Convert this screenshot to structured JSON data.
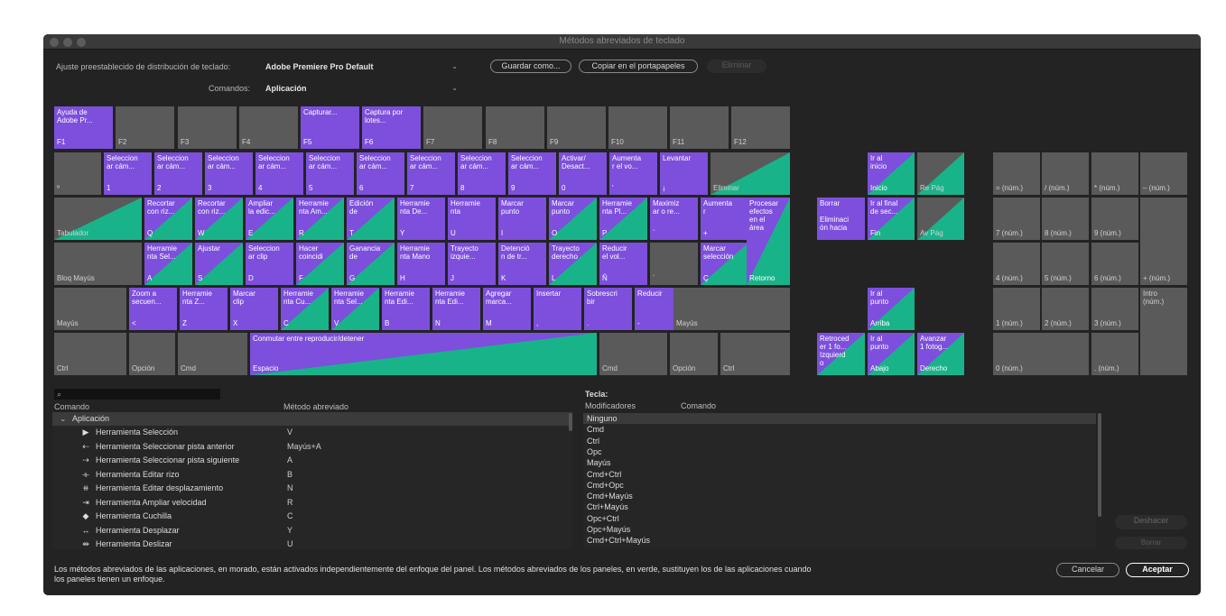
{
  "window": {
    "title": "Métodos abreviados de teclado"
  },
  "toolbar": {
    "preset_label": "Ajuste preestablecido de distribución de teclado:",
    "preset_value": "Adobe Premiere Pro Default",
    "commands_label": "Comandos:",
    "commands_value": "Aplicación",
    "save_as": "Guardar como...",
    "copy_clipboard": "Copiar en el portapapeles",
    "delete": "Eliminar"
  },
  "keyboard": {
    "fn_row": [
      {
        "t": "Ayuda de\nAdobe Pr...",
        "n": "F1",
        "c": "p"
      },
      {
        "t": "",
        "n": "F2",
        "c": "g"
      },
      {
        "t": "",
        "n": "F3",
        "c": "g"
      },
      {
        "t": "",
        "n": "F4",
        "c": "g"
      },
      {
        "t": "Capturar...",
        "n": "F5",
        "c": "p"
      },
      {
        "t": "Captura por\nlotes...",
        "n": "F6",
        "c": "p"
      },
      {
        "t": "",
        "n": "F7",
        "c": "g"
      },
      {
        "t": "",
        "n": "F8",
        "c": "g"
      },
      {
        "t": "",
        "n": "F9",
        "c": "g"
      },
      {
        "t": "",
        "n": "F10",
        "c": "g"
      },
      {
        "t": "",
        "n": "F11",
        "c": "g"
      },
      {
        "t": "",
        "n": "F12",
        "c": "g"
      }
    ],
    "num_row": [
      {
        "t": "",
        "n": "º",
        "c": "g"
      },
      {
        "t": "Seleccion\nar cám...",
        "n": "1",
        "c": "p"
      },
      {
        "t": "Seleccion\nar cám...",
        "n": "2",
        "c": "p"
      },
      {
        "t": "Seleccion\nar cám...",
        "n": "3",
        "c": "p"
      },
      {
        "t": "Seleccion\nar cám...",
        "n": "4",
        "c": "p"
      },
      {
        "t": "Seleccion\nar cám...",
        "n": "5",
        "c": "p"
      },
      {
        "t": "Seleccion\nar cám...",
        "n": "6",
        "c": "p"
      },
      {
        "t": "Seleccion\nar cám...",
        "n": "7",
        "c": "p"
      },
      {
        "t": "Seleccion\nar cám...",
        "n": "8",
        "c": "p"
      },
      {
        "t": "Seleccion\nar cám...",
        "n": "9",
        "c": "p"
      },
      {
        "t": "Activar/\nDesact...",
        "n": "0",
        "c": "p"
      },
      {
        "t": "Aumenta\nr el vo...",
        "n": "'",
        "c": "p"
      },
      {
        "t": "Levantar",
        "n": "¡",
        "c": "p"
      },
      {
        "t": "",
        "n": "Eliminar",
        "c": "gt"
      }
    ],
    "q_row": [
      {
        "t": "",
        "n": "Tabulador",
        "c": "gt"
      },
      {
        "t": "Recortar\ncon riz...",
        "n": "Q",
        "c": "pt"
      },
      {
        "t": "Recortar\ncon riz...",
        "n": "W",
        "c": "pt"
      },
      {
        "t": "Ampliar\nla edic...",
        "n": "E",
        "c": "pt"
      },
      {
        "t": "Herramie\nnta Am...",
        "n": "R",
        "c": "pt"
      },
      {
        "t": "Edición\nde",
        "n": "T",
        "c": "pt"
      },
      {
        "t": "Herramie\nnta De...",
        "n": "Y",
        "c": "p"
      },
      {
        "t": "Herramie\nnta",
        "n": "U",
        "c": "p"
      },
      {
        "t": "Marcar\npunto",
        "n": "I",
        "c": "p"
      },
      {
        "t": "Marcar\npunto",
        "n": "O",
        "c": "pt"
      },
      {
        "t": "Herramie\nnta Pl...",
        "n": "P",
        "c": "pt"
      },
      {
        "t": "Maximiz\nar o re...",
        "n": "`",
        "c": "p"
      },
      {
        "t": "Aumenta\nr",
        "n": "+",
        "c": "p"
      }
    ],
    "a_row": [
      {
        "t": "",
        "n": "Bloq Mayús",
        "c": "g"
      },
      {
        "t": "Herramie\nnta Sel...",
        "n": "A",
        "c": "pt"
      },
      {
        "t": "Ajustar",
        "n": "S",
        "c": "pt"
      },
      {
        "t": "Seleccion\nar clip",
        "n": "D",
        "c": "p"
      },
      {
        "t": "Hacer\ncoincidi",
        "n": "F",
        "c": "pt"
      },
      {
        "t": "Ganancia\nde",
        "n": "G",
        "c": "pt"
      },
      {
        "t": "Herramie\nnta Mano",
        "n": "H",
        "c": "p"
      },
      {
        "t": "Trayecto\nizquie...",
        "n": "J",
        "c": "p"
      },
      {
        "t": "Detenció\nn de tr...",
        "n": "K",
        "c": "p"
      },
      {
        "t": "Trayecto\nderecho",
        "n": "L",
        "c": "pt"
      },
      {
        "t": "Reducir\nel vol...",
        "n": "Ñ",
        "c": "p"
      },
      {
        "t": "",
        "n": "´",
        "c": "g"
      },
      {
        "t": "Marcar\nselección",
        "n": "Ç",
        "c": "pt"
      }
    ],
    "ret_key": {
      "t": "Procesar\nefectos\nen el\nárea",
      "n": "Retorno"
    },
    "z_row": [
      {
        "t": "",
        "n": "Mayús",
        "c": "g"
      },
      {
        "t": "Zoom a\nsecuen...",
        "n": "<",
        "c": "p"
      },
      {
        "t": "Herramie\nnta Z...",
        "n": "Z",
        "c": "p"
      },
      {
        "t": "Marcar\nclip",
        "n": "X",
        "c": "p"
      },
      {
        "t": "Herramie\nnta Cu...",
        "n": "C",
        "c": "pt"
      },
      {
        "t": "Herramie\nnta Sel...",
        "n": "V",
        "c": "pt"
      },
      {
        "t": "Herramie\nnta Edi...",
        "n": "B",
        "c": "p"
      },
      {
        "t": "Herramie\nnta Edi...",
        "n": "N",
        "c": "p"
      },
      {
        "t": "Agregar\nmarca...",
        "n": "M",
        "c": "p"
      },
      {
        "t": "Insertar",
        "n": ",",
        "c": "p"
      },
      {
        "t": "Sobrescri\nbir",
        "n": ".",
        "c": "p"
      },
      {
        "t": "Reducir",
        "n": "-",
        "c": "p"
      },
      {
        "t": "",
        "n": "Mayús",
        "c": "g"
      }
    ],
    "bottom_row": [
      {
        "t": "",
        "n": "Ctrl",
        "c": "g"
      },
      {
        "t": "",
        "n": "Opción",
        "c": "g"
      },
      {
        "t": "",
        "n": "Cmd",
        "c": "g"
      },
      {
        "t": "Conmutar entre reproducir/detener",
        "n": "Espacio",
        "c": "pt"
      },
      {
        "t": "",
        "n": "Cmd",
        "c": "g"
      },
      {
        "t": "",
        "n": "Opción",
        "c": "g"
      },
      {
        "t": "",
        "n": "Ctrl",
        "c": "g"
      }
    ],
    "nav_keys": [
      {
        "t": "Ir al\ninicio",
        "n": "Inicio",
        "c": "pt"
      },
      {
        "t": "",
        "n": "Re Pág",
        "c": "gt"
      },
      {
        "t": "Borrar\n\nEliminaci\nón hacia",
        "n": "",
        "c": "p"
      },
      {
        "t": "Ir al final\nde sec...",
        "n": "Fin",
        "c": "pt"
      },
      {
        "t": "",
        "n": "Av Pág",
        "c": "gt"
      },
      {
        "t": "Ir al\npunto",
        "n": "Arriba",
        "c": "pt"
      },
      {
        "t": "Retroced\ner 1 fo...\nIzquierd\no",
        "n": "",
        "c": "pt"
      },
      {
        "t": "Ir al\npunto",
        "n": "Abajo",
        "c": "pt"
      },
      {
        "t": "Avanzar\n1 fotog...",
        "n": "Derecho",
        "c": "pt"
      }
    ],
    "numpad": [
      {
        "t": "",
        "n": "= (núm.)"
      },
      {
        "t": "",
        "n": "/ (núm.)"
      },
      {
        "t": "",
        "n": "* (núm.)"
      },
      {
        "t": "",
        "n": "– (núm.)"
      },
      {
        "t": "",
        "n": "7 (núm.)"
      },
      {
        "t": "",
        "n": "8 (núm.)"
      },
      {
        "t": "",
        "n": "9 (núm.)"
      },
      {
        "t": "",
        "n": "+ (núm.)"
      },
      {
        "t": "",
        "n": "4 (núm.)"
      },
      {
        "t": "",
        "n": "5 (núm.)"
      },
      {
        "t": "",
        "n": "6 (núm.)"
      },
      {
        "t": "",
        "n": "1 (núm.)"
      },
      {
        "t": "",
        "n": "2 (núm.)"
      },
      {
        "t": "",
        "n": "3 (núm.)"
      },
      {
        "t": "Intro\n(núm.)",
        "n": ""
      },
      {
        "t": "",
        "n": "0 (núm.)"
      },
      {
        "t": "",
        "n": ". (núm.)"
      }
    ]
  },
  "command_panel": {
    "search_icon": "search-icon",
    "col_command": "Comando",
    "col_shortcut": "Método abreviado",
    "group": "Aplicación",
    "rows": [
      {
        "icon": "▶",
        "label": "Herramienta Selección",
        "shortcut": "V"
      },
      {
        "icon": "⇠",
        "label": "Herramienta Seleccionar pista anterior",
        "shortcut": "Mayús+A"
      },
      {
        "icon": "⇢",
        "label": "Herramienta Seleccionar pista siguiente",
        "shortcut": "A"
      },
      {
        "icon": "⟛",
        "label": "Herramienta Editar rizo",
        "shortcut": "B"
      },
      {
        "icon": "⧺",
        "label": "Herramienta Editar desplazamiento",
        "shortcut": "N"
      },
      {
        "icon": "⇥",
        "label": "Herramienta Ampliar velocidad",
        "shortcut": "R"
      },
      {
        "icon": "◆",
        "label": "Herramienta Cuchilla",
        "shortcut": "C"
      },
      {
        "icon": "↔",
        "label": "Herramienta Desplazar",
        "shortcut": "Y"
      },
      {
        "icon": "⇹",
        "label": "Herramienta Deslizar",
        "shortcut": "U"
      }
    ]
  },
  "key_panel": {
    "key_label": "Tecla:",
    "col_modifiers": "Modificadores",
    "col_command": "Comando",
    "modifiers": [
      "Ninguno",
      "Cmd",
      "Ctrl",
      "Opc",
      "Mayús",
      "Cmd+Ctrl",
      "Cmd+Opc",
      "Cmd+Mayús",
      "Ctrl+Mayús",
      "Opc+Ctrl",
      "Opc+Mayús",
      "Cmd+Ctrl+Mayús"
    ],
    "undo": "Deshacer",
    "clear": "Borrar"
  },
  "footer": {
    "text": "Los métodos abreviados de las aplicaciones, en morado, están activados independientemente del enfoque del panel. Los métodos abreviados de los paneles, en verde, sustituyen los de las aplicaciones cuando los paneles tienen un enfoque.",
    "cancel": "Cancelar",
    "accept": "Aceptar"
  },
  "colors": {
    "app_purple": "#7d4fdc",
    "panel_green": "#19b38a",
    "key_gray": "#5a5a5a",
    "window_bg": "#232323"
  }
}
